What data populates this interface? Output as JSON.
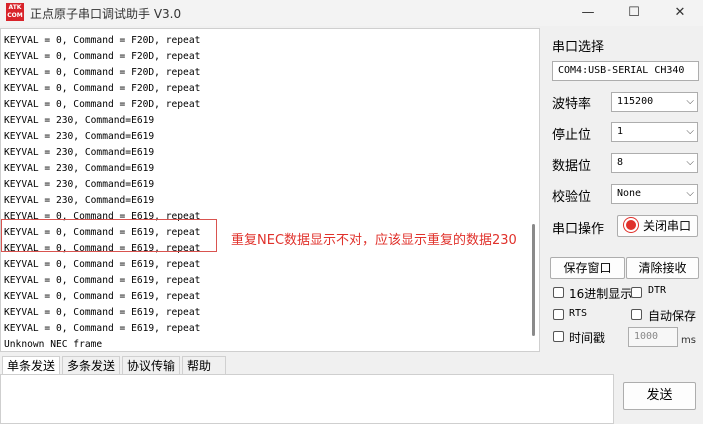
{
  "window": {
    "title": "正点原子串口调试助手 V3.0",
    "logo_text": "ATK\nCOM",
    "minimize": "—",
    "maximize": "☐",
    "close": "✕"
  },
  "terminal": {
    "lines": [
      "KEYVAL = 0, Command = F20D, repeat",
      "KEYVAL = 0, Command = F20D, repeat",
      "KEYVAL = 0, Command = F20D, repeat",
      "KEYVAL = 0, Command = F20D, repeat",
      "KEYVAL = 0, Command = F20D, repeat",
      "KEYVAL = 230, Command=E619",
      "KEYVAL = 230, Command=E619",
      "KEYVAL = 230, Command=E619",
      "KEYVAL = 230, Command=E619",
      "KEYVAL = 230, Command=E619",
      "KEYVAL = 230, Command=E619",
      "KEYVAL = 0, Command = E619, repeat",
      "KEYVAL = 0, Command = E619, repeat",
      "KEYVAL = 0, Command = E619, repeat",
      "KEYVAL = 0, Command = E619, repeat",
      "KEYVAL = 0, Command = E619, repeat",
      "KEYVAL = 0, Command = E619, repeat",
      "KEYVAL = 0, Command = E619, repeat",
      "KEYVAL = 0, Command = E619, repeat",
      "Unknown NEC frame"
    ],
    "annotation": "重复NEC数据显示不对，应该显示重复的数据230"
  },
  "settings": {
    "port_label": "串口选择",
    "port_value": "COM4:USB-SERIAL CH340",
    "baud_label": "波特率",
    "baud_value": "115200",
    "stop_label": "停止位",
    "stop_value": "1",
    "data_label": "数据位",
    "data_value": "8",
    "parity_label": "校验位",
    "parity_value": "None",
    "op_label": "串口操作",
    "close_port": "关闭串口",
    "save_window": "保存窗口",
    "clear_receive": "清除接收",
    "hex_display": "16进制显示",
    "dtr": "DTR",
    "rts": "RTS",
    "auto_save": "自动保存",
    "timestamp": "时间戳",
    "interval_value": "1000",
    "interval_unit": "ms"
  },
  "tabs": [
    "单条发送",
    "多条发送",
    "协议传输",
    "帮助"
  ],
  "send": {
    "button": "发送"
  },
  "colors": {
    "accent": "#e0312b",
    "logo_bg": "#d8232a"
  }
}
